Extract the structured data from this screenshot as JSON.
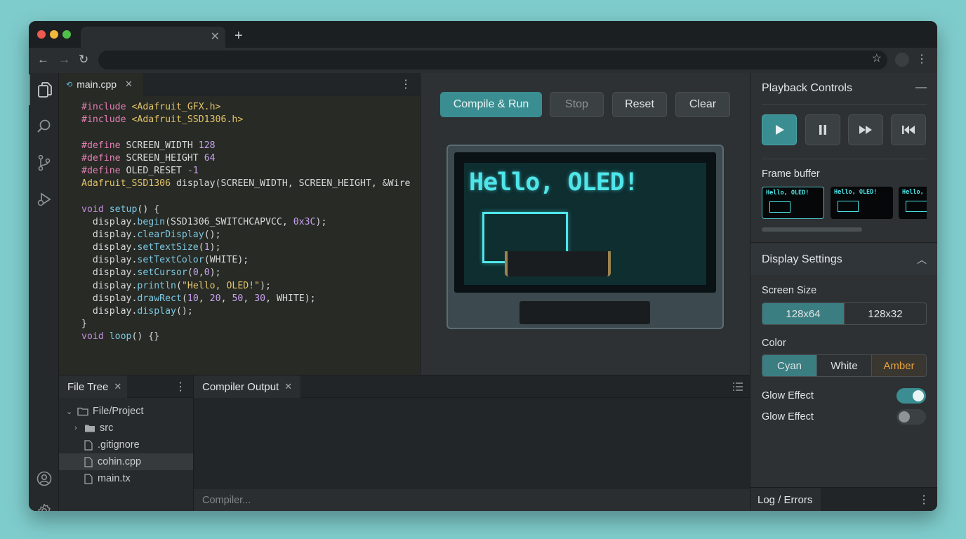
{
  "browser": {
    "tab_title": "",
    "url": ""
  },
  "editor": {
    "tab_label": "main.cpp",
    "lines": [
      [
        {
          "t": "#include ",
          "c": "pp"
        },
        {
          "t": "<Adafruit_GFX.h>",
          "c": "str"
        }
      ],
      [
        {
          "t": "#include ",
          "c": "pp"
        },
        {
          "t": "<Adafruit_SSD1306.h>",
          "c": "str"
        }
      ],
      [],
      [
        {
          "t": "#define ",
          "c": "pp"
        },
        {
          "t": "SCREEN_WIDTH "
        },
        {
          "t": "128",
          "c": "num"
        }
      ],
      [
        {
          "t": "#define ",
          "c": "pp"
        },
        {
          "t": "SCREEN_HEIGHT "
        },
        {
          "t": "64",
          "c": "num"
        }
      ],
      [
        {
          "t": "#define ",
          "c": "pp"
        },
        {
          "t": "OLED_RESET "
        },
        {
          "t": "-1",
          "c": "num"
        }
      ],
      [
        {
          "t": "Adafruit_SSD1306 ",
          "c": "str"
        },
        {
          "t": "display(SCREEN_WIDTH, SCREEN_HEIGHT, &Wire"
        }
      ],
      [],
      [
        {
          "t": "void ",
          "c": "kw"
        },
        {
          "t": "setup",
          "c": "fn"
        },
        {
          "t": "() {"
        }
      ],
      [
        {
          "t": "  display."
        },
        {
          "t": "begin",
          "c": "fn"
        },
        {
          "t": "(SSD1306_SWITCHCAPVCC, "
        },
        {
          "t": "0x3C",
          "c": "num"
        },
        {
          "t": ");"
        }
      ],
      [
        {
          "t": "  display."
        },
        {
          "t": "clearDisplay",
          "c": "fn"
        },
        {
          "t": "();"
        }
      ],
      [
        {
          "t": "  display."
        },
        {
          "t": "setTextSize",
          "c": "fn"
        },
        {
          "t": "("
        },
        {
          "t": "1",
          "c": "num"
        },
        {
          "t": ");"
        }
      ],
      [
        {
          "t": "  display."
        },
        {
          "t": "setTextColor",
          "c": "fn"
        },
        {
          "t": "(WHITE);"
        }
      ],
      [
        {
          "t": "  display."
        },
        {
          "t": "setCursor",
          "c": "fn"
        },
        {
          "t": "("
        },
        {
          "t": "0",
          "c": "num"
        },
        {
          "t": ","
        },
        {
          "t": "0",
          "c": "num"
        },
        {
          "t": ");"
        }
      ],
      [
        {
          "t": "  display."
        },
        {
          "t": "println",
          "c": "fn"
        },
        {
          "t": "("
        },
        {
          "t": "\"Hello, OLED!\"",
          "c": "str"
        },
        {
          "t": ");"
        }
      ],
      [
        {
          "t": "  display."
        },
        {
          "t": "drawRect",
          "c": "fn"
        },
        {
          "t": "("
        },
        {
          "t": "10",
          "c": "num"
        },
        {
          "t": ", "
        },
        {
          "t": "20",
          "c": "num"
        },
        {
          "t": ", "
        },
        {
          "t": "50",
          "c": "num"
        },
        {
          "t": ", "
        },
        {
          "t": "30",
          "c": "num"
        },
        {
          "t": ", WHITE);"
        }
      ],
      [
        {
          "t": "  display."
        },
        {
          "t": "display",
          "c": "fn"
        },
        {
          "t": "();"
        }
      ],
      [
        {
          "t": "}"
        }
      ],
      [
        {
          "t": "void ",
          "c": "kw"
        },
        {
          "t": "loop",
          "c": "fn"
        },
        {
          "t": "() {}"
        }
      ]
    ]
  },
  "toolbar": {
    "compile_run": "Compile & Run",
    "stop": "Stop",
    "reset": "Reset",
    "clear": "Clear"
  },
  "oled": {
    "text": "Hello, OLED!",
    "color": "#4fe6ea"
  },
  "file_tree": {
    "tab_label": "File Tree",
    "root": "File/Project",
    "items": [
      {
        "label": "src",
        "type": "folder"
      },
      {
        "label": ".gitignore",
        "type": "file"
      },
      {
        "label": "cohin.cpp",
        "type": "file",
        "selected": true
      },
      {
        "label": "main.tx",
        "type": "file"
      }
    ]
  },
  "output": {
    "tab_label": "Compiler Output",
    "input_placeholder": "Compiler..."
  },
  "right_panel": {
    "playback_title": "Playback Controls",
    "frame_buffer_label": "Frame buffer",
    "frames": [
      "Hello, OLED!",
      "Hello, OLED!",
      "Hello, O"
    ],
    "display_settings_title": "Display Settings",
    "screen_size_label": "Screen Size",
    "screen_sizes": [
      "128x64",
      "128x32"
    ],
    "color_label": "Color",
    "colors": [
      "Cyan",
      "White",
      "Amber"
    ],
    "glow1_label": "Glow Effect",
    "glow2_label": "Glow Effect",
    "glow1_on": true,
    "glow2_on": false,
    "log_tab": "Log / Errors"
  },
  "accent": "#3a8e91"
}
